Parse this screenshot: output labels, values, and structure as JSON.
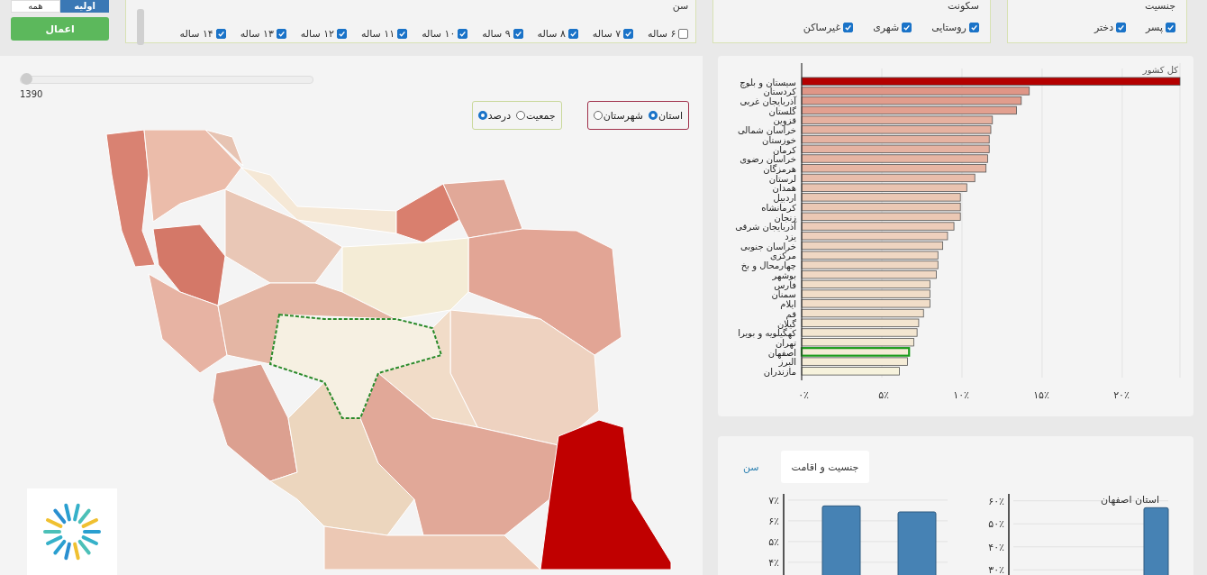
{
  "filters": {
    "toggle": [
      {
        "label": "اولیه",
        "selected": true
      },
      {
        "label": "همه",
        "selected": false
      }
    ],
    "apply_button": "اعمال",
    "groups": [
      {
        "title": "جنسیت",
        "options": [
          {
            "label": "پسر",
            "checked": true
          },
          {
            "label": "دختر",
            "checked": true
          }
        ]
      },
      {
        "title": "سکونت",
        "options": [
          {
            "label": "روستایی",
            "checked": true
          },
          {
            "label": "شهری",
            "checked": true
          },
          {
            "label": "غیرساکن",
            "checked": true
          }
        ]
      },
      {
        "title": "سن",
        "options": [
          {
            "label": "۶ ساله",
            "checked": false
          },
          {
            "label": "۷ ساله",
            "checked": true
          },
          {
            "label": "۸ ساله",
            "checked": true
          },
          {
            "label": "۹ ساله",
            "checked": true
          },
          {
            "label": "۱۰ ساله",
            "checked": true
          },
          {
            "label": "۱۱ ساله",
            "checked": true
          },
          {
            "label": "۱۲ ساله",
            "checked": true
          },
          {
            "label": "۱۳ ساله",
            "checked": true
          },
          {
            "label": "۱۴ ساله",
            "checked": true
          }
        ]
      }
    ]
  },
  "map_panel": {
    "year_slider": {
      "level": 0,
      "label": "1390"
    },
    "radio_groups": [
      {
        "kind": "division",
        "options": [
          {
            "label": "استان",
            "selected": true
          },
          {
            "label": "شهرستان",
            "selected": false
          }
        ]
      },
      {
        "kind": "measure",
        "options": [
          {
            "label": "جمعیت",
            "selected": false
          },
          {
            "label": "درصد",
            "selected": true
          }
        ]
      }
    ]
  },
  "ranking_panel": {
    "chart_data": {
      "type": "bar",
      "orientation": "horizontal",
      "title": "کل کشور",
      "categories": [
        "سیستان و بلوچ",
        "کردستان",
        "آذربایجان غربی",
        "گلستان",
        "قزوین",
        "خراسان شمالی",
        "خوزستان",
        "کرمان",
        "خراسان رضوی",
        "هرمزگان",
        "لرستان",
        "همدان",
        "اردبیل",
        "کرمانشاه",
        "زنجان",
        "آذربایجان شرقی",
        "یزد",
        "خراسان جنوبی",
        "مرکزی",
        "چهارمحال و بخ",
        "بوشهر",
        "فارس",
        "سمنان",
        "ایلام",
        "قم",
        "گیلان",
        "کهگیلویه و بویرا",
        "تهران",
        "اصفهان",
        "البرز",
        "مازندران"
      ],
      "values": [
        23.6,
        14.2,
        13.7,
        13.4,
        11.9,
        11.8,
        11.7,
        11.7,
        11.6,
        11.5,
        10.8,
        10.3,
        9.9,
        9.9,
        9.9,
        9.5,
        9.1,
        8.8,
        8.5,
        8.5,
        8.4,
        8.0,
        8.0,
        8.0,
        7.6,
        7.3,
        7.2,
        7.0,
        6.7,
        6.6,
        6.1
      ],
      "grid": true,
      "xlim": [
        0,
        23.6
      ],
      "xticks": [
        {
          "value": 0,
          "label": "۰٪"
        },
        {
          "value": 5,
          "label": "۵٪"
        },
        {
          "value": 10,
          "label": "۱۰٪"
        },
        {
          "value": 15,
          "label": "۱۵٪"
        },
        {
          "value": 20,
          "label": "۲۰٪"
        }
      ]
    },
    "bar_selected": [
      false,
      false,
      false,
      false,
      false,
      false,
      false,
      false,
      false,
      false,
      false,
      false,
      false,
      false,
      false,
      false,
      false,
      false,
      false,
      false,
      false,
      false,
      false,
      false,
      false,
      false,
      false,
      false,
      true,
      false,
      false
    ]
  },
  "detail_panel": {
    "tabs": [
      {
        "label": "جنسیت و اقامت",
        "selected": true
      },
      {
        "label": "سن",
        "selected": false
      }
    ],
    "charts": [
      {
        "chart_data": {
          "type": "bar",
          "title": "استان اصفهان",
          "values": [
            57
          ],
          "ylim": [
            27,
            63
          ],
          "grid": true,
          "yticks": [
            {
              "value": 30,
              "label": "۳۰٪"
            },
            {
              "value": 40,
              "label": "۴۰٪"
            },
            {
              "value": 50,
              "label": "۵۰٪"
            },
            {
              "value": 60,
              "label": "۶۰٪"
            }
          ]
        }
      },
      {
        "chart_data": {
          "type": "bar",
          "values": [
            6.72,
            6.43
          ],
          "ylim": [
            3.3,
            7.3
          ],
          "grid": true,
          "yticks": [
            {
              "value": 4,
              "label": "۴٪"
            },
            {
              "value": 5,
              "label": "۵٪"
            },
            {
              "value": 6,
              "label": "۶٪"
            },
            {
              "value": 7,
              "label": "۷٪"
            }
          ]
        }
      }
    ]
  }
}
